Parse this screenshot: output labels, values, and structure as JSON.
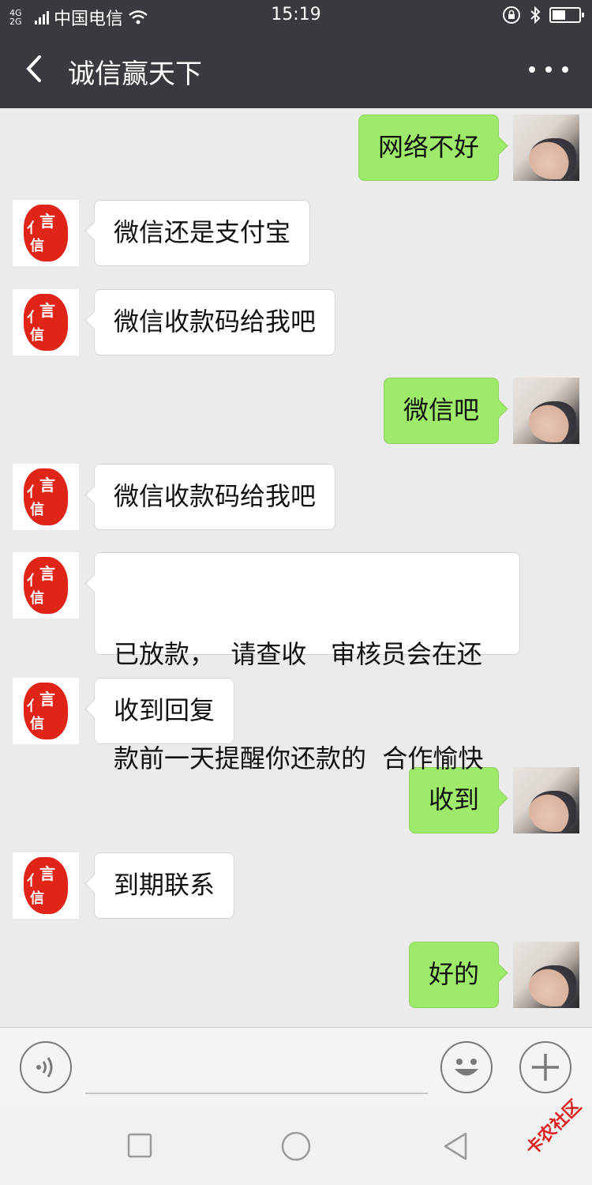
{
  "status_bar": {
    "network_type": "4G 2G",
    "carrier": "中国电信",
    "time": "15:19",
    "icons": [
      "signal-icon",
      "wifi-icon",
      "lock-rotation-icon",
      "bluetooth-icon",
      "battery-icon"
    ],
    "battery_level": 0.5
  },
  "header": {
    "title": "诚信赢天下",
    "back_icon": "back-chevron-icon",
    "more_icon": "more-dots-icon"
  },
  "colors": {
    "header_bg": "#393a3f",
    "chat_bg": "#ebebeb",
    "sent_bubble": "#9eea6a",
    "received_bubble": "#ffffff",
    "seal_red": "#e02418"
  },
  "contact_avatar": {
    "seal_text": "信"
  },
  "messages": [
    {
      "side": "right",
      "text": "网络不好"
    },
    {
      "side": "left",
      "text": "微信还是支付宝"
    },
    {
      "side": "left",
      "text": "微信收款码给我吧"
    },
    {
      "side": "right",
      "text": "微信吧"
    },
    {
      "side": "left",
      "text": "微信收款码给我吧"
    },
    {
      "side": "left",
      "line1": "已放款，  请查收   审核员会在还",
      "line2": "款前一天提醒你还款的  合作愉快"
    },
    {
      "side": "left",
      "text": "收到回复"
    },
    {
      "side": "right",
      "text": "收到"
    },
    {
      "side": "left",
      "text": "到期联系"
    },
    {
      "side": "right",
      "text": "好的"
    }
  ],
  "input_bar": {
    "voice_icon": "voice-icon",
    "emoji_icon": "emoji-icon",
    "plus_icon": "plus-icon"
  },
  "nav_bar": {
    "icons": [
      "recent-apps-square-icon",
      "home-circle-icon",
      "back-triangle-icon"
    ]
  },
  "watermark": "卡农社区"
}
